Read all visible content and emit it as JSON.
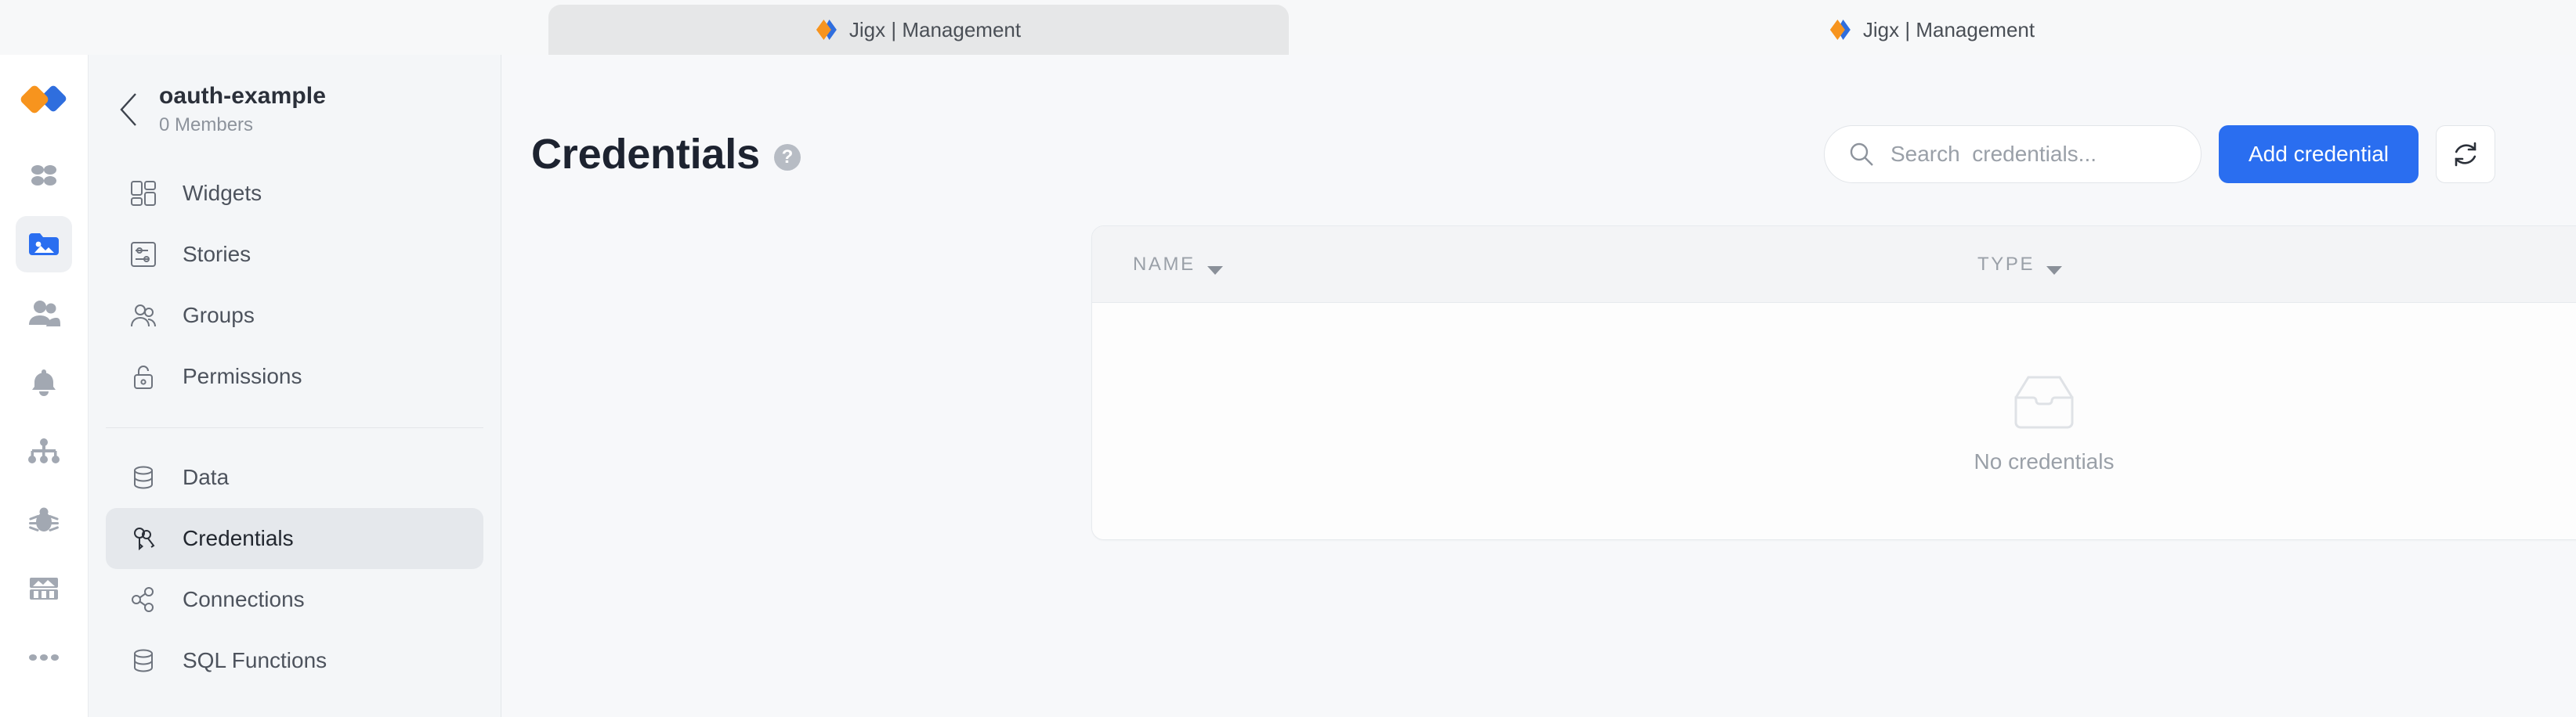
{
  "browser": {
    "tabs": [
      {
        "title": "Jigx | Management",
        "active": false,
        "favicon": "jigx-diamond-icon"
      },
      {
        "title": "Jigx | Management",
        "active": true,
        "favicon": "jigx-diamond-icon"
      }
    ]
  },
  "rail": {
    "logo": "jigx-logo-icon",
    "items": [
      {
        "name": "apps-grid-icon",
        "active": false
      },
      {
        "name": "media-folder-icon",
        "active": true
      },
      {
        "name": "people-icon",
        "active": false
      },
      {
        "name": "bell-icon",
        "active": false
      },
      {
        "name": "org-chart-icon",
        "active": false
      },
      {
        "name": "bug-icon",
        "active": false
      },
      {
        "name": "analytics-icon",
        "active": false
      },
      {
        "name": "more-icon",
        "active": false
      }
    ]
  },
  "sidebar": {
    "project_name": "oauth-example",
    "members": "0 Members",
    "back_icon": "chevron-left-icon",
    "group_one": [
      {
        "label": "Widgets",
        "icon": "widgets-icon",
        "active": false
      },
      {
        "label": "Stories",
        "icon": "stories-icon",
        "active": false
      },
      {
        "label": "Groups",
        "icon": "groups-icon",
        "active": false
      },
      {
        "label": "Permissions",
        "icon": "lock-icon",
        "active": false
      }
    ],
    "group_two": [
      {
        "label": "Data",
        "icon": "database-icon",
        "active": false
      },
      {
        "label": "Credentials",
        "icon": "keys-icon",
        "active": true
      },
      {
        "label": "Connections",
        "icon": "share-icon",
        "active": false
      },
      {
        "label": "SQL Functions",
        "icon": "database-icon",
        "active": false
      }
    ]
  },
  "main": {
    "title": "Credentials",
    "help_glyph": "?",
    "search": {
      "placeholder": "Search  credentials...",
      "value": "",
      "icon": "search-icon"
    },
    "add_button": "Add credential",
    "refresh_icon": "refresh-icon",
    "table": {
      "columns": [
        {
          "label": "NAME",
          "sort_icon": "chevron-down-icon"
        },
        {
          "label": "TYPE",
          "sort_icon": "chevron-down-icon"
        }
      ],
      "rows": [],
      "empty_icon": "empty-tray-icon",
      "empty_text": "No credentials"
    }
  },
  "colors": {
    "accent_blue": "#2a6ef0",
    "brand_orange": "#f7941e",
    "brand_blue": "#2f6ede",
    "page_bg": "#f7f8fa",
    "sidebar_bg": "#f4f6f8",
    "active_pill": "#e5e8ec"
  }
}
